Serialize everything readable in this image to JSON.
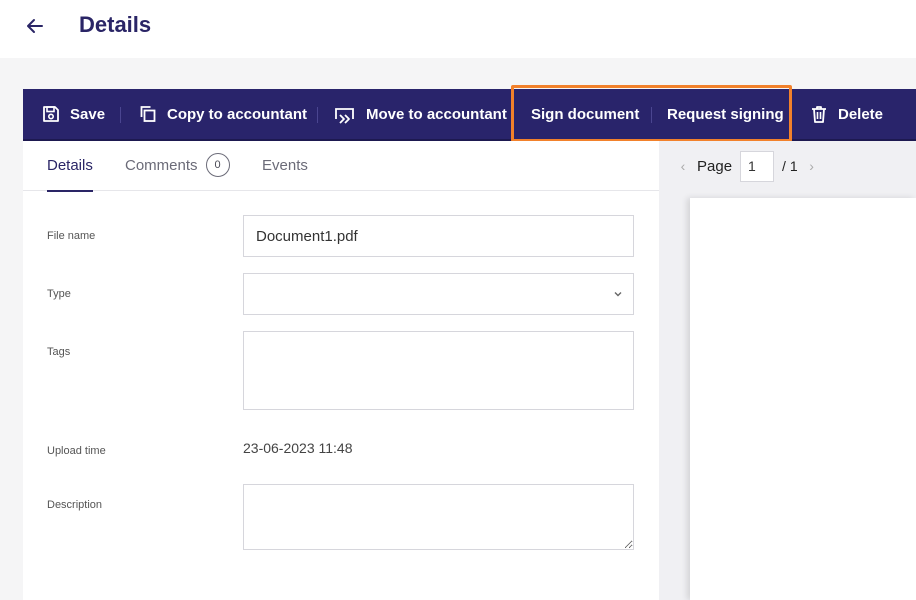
{
  "header": {
    "title": "Details"
  },
  "toolbar": {
    "save_label": "Save",
    "copy_label": "Copy to accountant",
    "move_label": "Move to accountant",
    "sign_label": "Sign document",
    "request_label": "Request signing",
    "delete_label": "Delete"
  },
  "tabs": {
    "details": "Details",
    "comments": "Comments",
    "comments_count": "0",
    "events": "Events"
  },
  "form": {
    "file_name_label": "File name",
    "file_name_value": "Document1.pdf",
    "type_label": "Type",
    "type_value": "",
    "tags_label": "Tags",
    "tags_value": "",
    "upload_time_label": "Upload time",
    "upload_time_value": "23-06-2023 11:48",
    "description_label": "Description",
    "description_value": ""
  },
  "viewer": {
    "page_label": "Page",
    "current_page": "1",
    "total_pages": "/ 1"
  },
  "colors": {
    "toolbar_bg": "#29246b",
    "title_color": "#2a2566",
    "highlight": "#f2812b"
  },
  "icons": {
    "back": "arrow-left-icon",
    "save": "floppy-disk-icon",
    "copy": "copy-icon",
    "move": "forward-arrow-icon",
    "delete": "trash-icon",
    "dropdown": "chevron-down-icon",
    "prev": "chevron-left-icon",
    "next": "chevron-right-icon"
  }
}
